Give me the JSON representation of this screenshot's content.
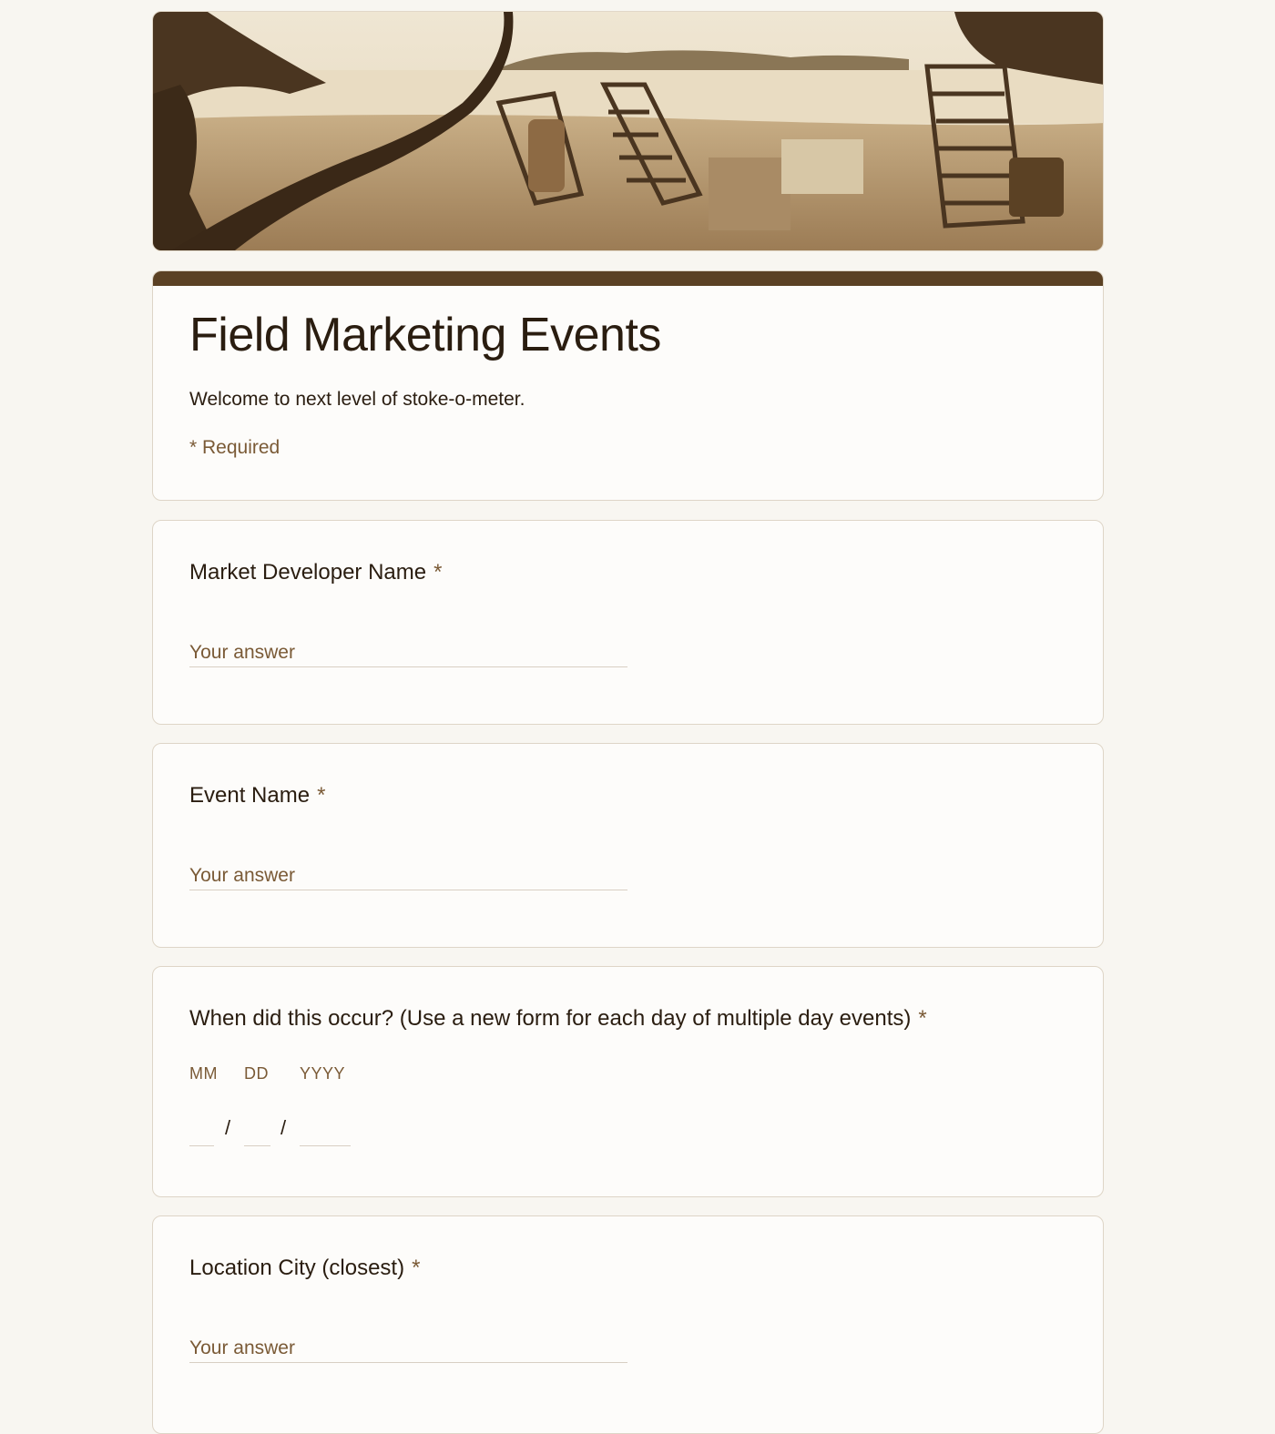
{
  "form": {
    "title": "Field Marketing Events",
    "description": "Welcome to next level of stoke-o-meter.",
    "required_note": "* Required"
  },
  "questions": [
    {
      "title": "Market Developer Name",
      "required_mark": "*",
      "placeholder": "Your answer"
    },
    {
      "title": "Event Name",
      "required_mark": "*",
      "placeholder": "Your answer"
    },
    {
      "title": "When did this occur? (Use a new form for each day of multiple day events)",
      "required_mark": "*",
      "date_labels": {
        "month": "MM",
        "day": "DD",
        "year": "YYYY"
      },
      "separator": "/"
    },
    {
      "title": "Location City (closest)",
      "required_mark": "*",
      "placeholder": "Your answer"
    }
  ],
  "theme": {
    "accent": "#5b4124",
    "background": "#f8f6f1",
    "label_color": "#7a5a36"
  }
}
